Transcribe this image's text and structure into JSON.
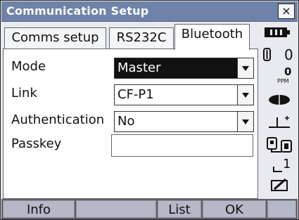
{
  "window": {
    "title": "Communication Setup",
    "close_label": "×"
  },
  "tabs": [
    {
      "label": "Comms setup",
      "active": false
    },
    {
      "label": "RS232C",
      "active": false
    },
    {
      "label": "Bluetooth",
      "active": true
    }
  ],
  "form": {
    "mode": {
      "label": "Mode",
      "value": "Master"
    },
    "link": {
      "label": "Link",
      "value": "CF-P1"
    },
    "authentication": {
      "label": "Authentication",
      "value": "No"
    },
    "passkey": {
      "label": "Passkey",
      "value": ""
    }
  },
  "status_panel": {
    "icons": [
      "battery-icon",
      "target-icon",
      "ppm-icon",
      "prism-icon",
      "tilt-icon",
      "interface-icon",
      "page-icon",
      "edit-icon"
    ],
    "target_constant": "0",
    "ppm_value": "0",
    "ppm_unit": "PPM",
    "page_number": "1"
  },
  "softkeys": [
    "Info",
    "",
    "List",
    "OK",
    ""
  ]
}
